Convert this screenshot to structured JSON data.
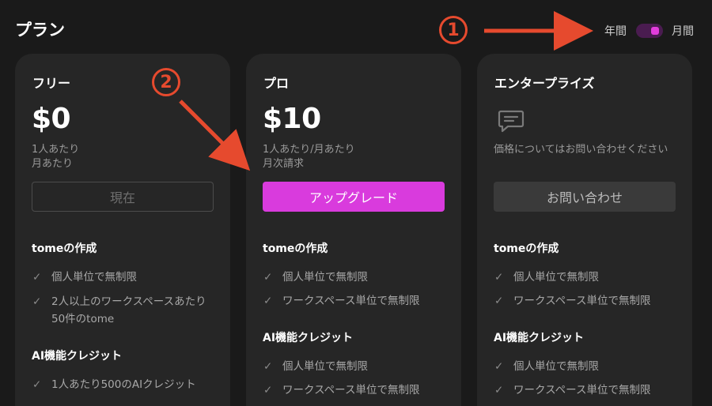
{
  "header": {
    "title": "プラン",
    "billing": {
      "yearly_label": "年間",
      "monthly_label": "月間",
      "selected": "monthly"
    }
  },
  "annotations": {
    "one": "1",
    "two": "2",
    "color": "#e64a2e"
  },
  "colors": {
    "accent": "#d93bdd",
    "card_bg": "#262626",
    "page_bg": "#1a1a1a"
  },
  "plans": [
    {
      "name": "フリー",
      "price": "$0",
      "sub_line1": "1人あたり",
      "sub_line2": "月あたり",
      "button": "現在",
      "sections": [
        {
          "title": "tomeの作成",
          "features": [
            "個人単位で無制限",
            "2人以上のワークスペースあたり50件のtome"
          ]
        },
        {
          "title": "AI機能クレジット",
          "features": [
            "1人あたり500のAIクレジット"
          ]
        }
      ]
    },
    {
      "name": "プロ",
      "price": "$10",
      "sub_line1": "1人あたり/月あたり",
      "sub_line2": "月次請求",
      "button": "アップグレード",
      "sections": [
        {
          "title": "tomeの作成",
          "features": [
            "個人単位で無制限",
            "ワークスペース単位で無制限"
          ]
        },
        {
          "title": "AI機能クレジット",
          "features": [
            "個人単位で無制限",
            "ワークスペース単位で無制限"
          ]
        }
      ]
    },
    {
      "name": "エンタープライズ",
      "icon": "chat-bubble-icon",
      "contact_note": "価格についてはお問い合わせください",
      "button": "お問い合わせ",
      "sections": [
        {
          "title": "tomeの作成",
          "features": [
            "個人単位で無制限",
            "ワークスペース単位で無制限"
          ]
        },
        {
          "title": "AI機能クレジット",
          "features": [
            "個人単位で無制限",
            "ワークスペース単位で無制限"
          ]
        }
      ]
    }
  ]
}
